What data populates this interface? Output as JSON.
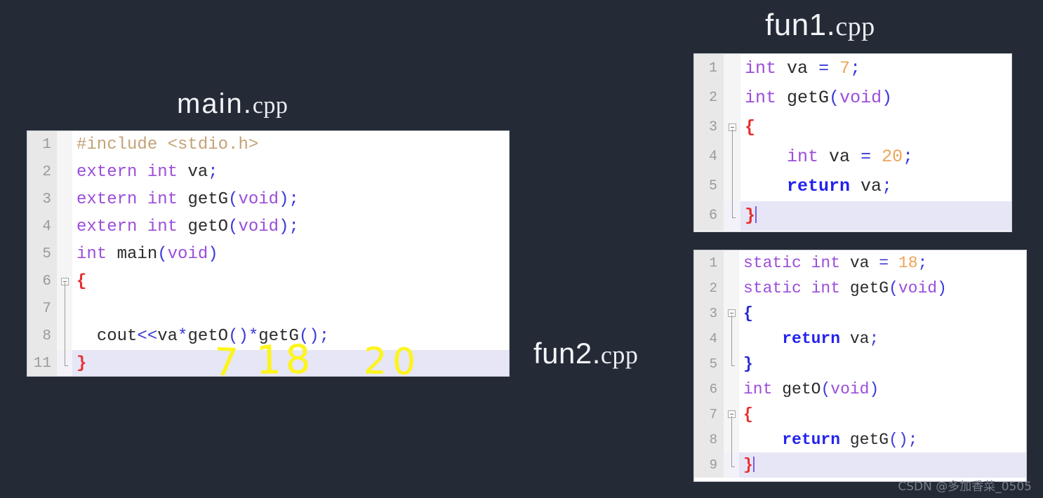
{
  "background_color": "#242b36",
  "files": [
    {
      "id": "main",
      "title_stem": "main.",
      "title_ext": "cpp",
      "lines": [
        {
          "num": "1",
          "fold": "none"
        },
        {
          "num": "2",
          "fold": "none"
        },
        {
          "num": "3",
          "fold": "none"
        },
        {
          "num": "4",
          "fold": "none"
        },
        {
          "num": "5",
          "fold": "none"
        },
        {
          "num": "6",
          "fold": "box"
        },
        {
          "num": "7",
          "fold": "line"
        },
        {
          "num": "8",
          "fold": "line"
        },
        {
          "num": "11",
          "fold": "end",
          "selected": true
        }
      ],
      "code": [
        "#include <stdio.h>",
        "extern int va;",
        "extern int getG(void);",
        "extern int getO(void);",
        "int main(void)",
        "{",
        "",
        "  cout<<va*getO()*getG();",
        "}"
      ]
    },
    {
      "id": "fun1",
      "title_stem": "fun1.",
      "title_ext": "cpp",
      "lines": [
        {
          "num": "1",
          "fold": "none"
        },
        {
          "num": "2",
          "fold": "none"
        },
        {
          "num": "3",
          "fold": "box"
        },
        {
          "num": "4",
          "fold": "line"
        },
        {
          "num": "5",
          "fold": "line"
        },
        {
          "num": "6",
          "fold": "end",
          "selected": true
        }
      ],
      "code": [
        "int va = 7;",
        "int getG(void)",
        "{",
        "    int va = 20;",
        "    return va;",
        "}"
      ]
    },
    {
      "id": "fun2",
      "title_stem": "fun2.",
      "title_ext": "cpp",
      "lines": [
        {
          "num": "1",
          "fold": "none"
        },
        {
          "num": "2",
          "fold": "none"
        },
        {
          "num": "3",
          "fold": "box"
        },
        {
          "num": "4",
          "fold": "line"
        },
        {
          "num": "5",
          "fold": "end"
        },
        {
          "num": "6",
          "fold": "none"
        },
        {
          "num": "7",
          "fold": "box"
        },
        {
          "num": "8",
          "fold": "line"
        },
        {
          "num": "9",
          "fold": "end",
          "selected": true
        }
      ],
      "code": [
        "static int va = 18;",
        "static int getG(void)",
        "{",
        "    return va;",
        "}",
        "int getO(void)",
        "{",
        "    return getG();",
        "}"
      ]
    }
  ],
  "annotations": {
    "ink_color": "#fdf51c",
    "marks": [
      {
        "id": "va_value",
        "text": "7"
      },
      {
        "id": "getO_value",
        "text": "18"
      },
      {
        "id": "getG_value",
        "text": "20"
      }
    ]
  },
  "watermark": "CSDN @多加香菜_0505",
  "syntax_colors": {
    "keyword": "#9b4ddb",
    "number": "#f0a355",
    "preprocessor": "#c4a276",
    "return_keyword": "#2222ee",
    "brace_red": "#e83030",
    "brace_blue": "#2a2ad0",
    "identifier": "#2b2b2b",
    "selected_line": "#e6e6f7",
    "gutter_bg": "#e8e8e8",
    "gutter_text": "#9a9a9a"
  }
}
